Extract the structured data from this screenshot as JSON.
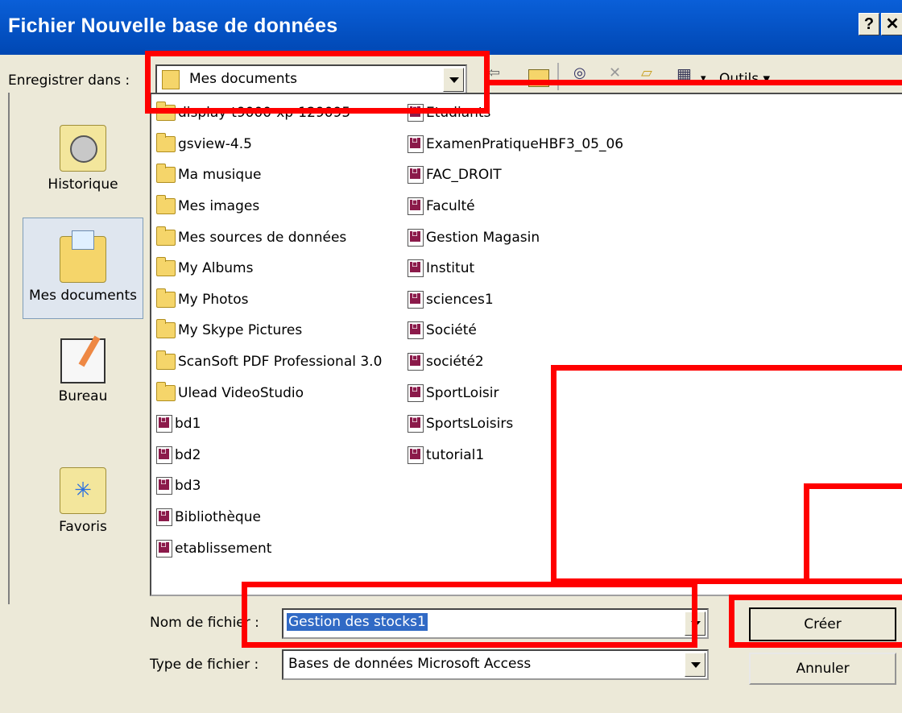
{
  "dialog": {
    "title": "Fichier Nouvelle base de données",
    "help_button": "?",
    "close_button": "✕"
  },
  "save_in": {
    "label": "Enregistrer dans :",
    "value": "Mes documents"
  },
  "toolbar": {
    "tools_label": "Outils ▾",
    "icons": [
      "back-icon",
      "up-folder-icon",
      "search-web-icon",
      "delete-icon",
      "new-folder-icon",
      "views-icon"
    ]
  },
  "places": [
    {
      "label": "Historique",
      "icon": "history-icon"
    },
    {
      "label": "Mes documents",
      "icon": "my-documents-icon"
    },
    {
      "label": "Bureau",
      "icon": "desktop-icon"
    },
    {
      "label": "Favoris",
      "icon": "favorites-icon"
    }
  ],
  "files": {
    "col1": [
      {
        "name": "display-t9000-xp-129095",
        "type": "folder"
      },
      {
        "name": "gsview-4.5",
        "type": "folder"
      },
      {
        "name": "Ma musique",
        "type": "folder"
      },
      {
        "name": "Mes images",
        "type": "folder"
      },
      {
        "name": "Mes sources de données",
        "type": "folder"
      },
      {
        "name": "My Albums",
        "type": "folder"
      },
      {
        "name": "My Photos",
        "type": "folder"
      },
      {
        "name": "My Skype Pictures",
        "type": "folder"
      },
      {
        "name": "ScanSoft PDF Professional 3.0",
        "type": "folder"
      },
      {
        "name": "Ulead VideoStudio",
        "type": "folder"
      },
      {
        "name": "bd1",
        "type": "mdb"
      },
      {
        "name": "bd2",
        "type": "mdb"
      },
      {
        "name": "bd3",
        "type": "mdb"
      },
      {
        "name": "Bibliothèque",
        "type": "mdb"
      },
      {
        "name": "etablissement",
        "type": "mdb"
      }
    ],
    "col2": [
      {
        "name": "Etudiants",
        "type": "mdb"
      },
      {
        "name": "ExamenPratiqueHBF3_05_06",
        "type": "mdb"
      },
      {
        "name": "FAC_DROIT",
        "type": "mdb"
      },
      {
        "name": "Faculté",
        "type": "mdb"
      },
      {
        "name": "Gestion Magasin",
        "type": "mdb"
      },
      {
        "name": "Institut",
        "type": "mdb"
      },
      {
        "name": "sciences1",
        "type": "mdb"
      },
      {
        "name": "Société",
        "type": "mdb"
      },
      {
        "name": "société2",
        "type": "mdb"
      },
      {
        "name": "SportLoisir",
        "type": "mdb"
      },
      {
        "name": "SportsLoisirs",
        "type": "mdb"
      },
      {
        "name": "tutorial1",
        "type": "mdb"
      }
    ]
  },
  "filename": {
    "label": "Nom de fichier :",
    "value": "Gestion des stocks1"
  },
  "filetype": {
    "label": "Type de fichier :",
    "value": "Bases de données Microsoft Access"
  },
  "buttons": {
    "create": "Créer",
    "cancel": "Annuler"
  },
  "colors": {
    "title_bar": "#0050d0",
    "highlight": "#316ac5",
    "annotation": "#ff0000"
  }
}
